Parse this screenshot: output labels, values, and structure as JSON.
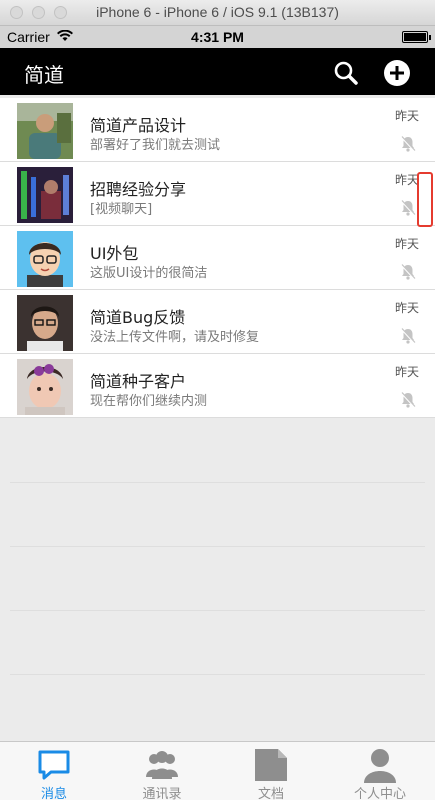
{
  "window": {
    "title": "iPhone 6 - iPhone 6 / iOS 9.1 (13B137)"
  },
  "status": {
    "carrier": "Carrier",
    "time": "4:31 PM",
    "battery_level": 1.0
  },
  "nav": {
    "title": "简道",
    "search_icon": "search-icon",
    "add_icon": "plus-circle-icon"
  },
  "conversations": [
    {
      "title": "简道产品设计",
      "subtitle": "部署好了我们就去测试",
      "time": "昨天",
      "avatar": "photo-man-outdoor",
      "muted": true
    },
    {
      "title": "招聘经验分享",
      "subtitle": "[视频聊天]",
      "time": "昨天",
      "avatar": "photo-concert",
      "muted": true
    },
    {
      "title": "UI外包",
      "subtitle": "这版UI设计的很简洁",
      "time": "昨天",
      "avatar": "cartoon-boy",
      "muted": true
    },
    {
      "title": "简道Bug反馈",
      "subtitle": "没法上传文件啊，请及时修复",
      "time": "昨天",
      "avatar": "photo-man-glasses",
      "muted": true
    },
    {
      "title": "简道种子客户",
      "subtitle": "现在帮你们继续内测",
      "time": "昨天",
      "avatar": "photo-baby",
      "muted": true
    }
  ],
  "tabs": [
    {
      "label": "消息",
      "icon": "chat-bubble-icon",
      "active": true
    },
    {
      "label": "通讯录",
      "icon": "contacts-icon",
      "active": false
    },
    {
      "label": "文档",
      "icon": "document-icon",
      "active": false
    },
    {
      "label": "个人中心",
      "icon": "person-icon",
      "active": false
    }
  ],
  "colors": {
    "accent": "#1a8be6",
    "navbar": "#000000",
    "highlight": "#e53b2f"
  }
}
